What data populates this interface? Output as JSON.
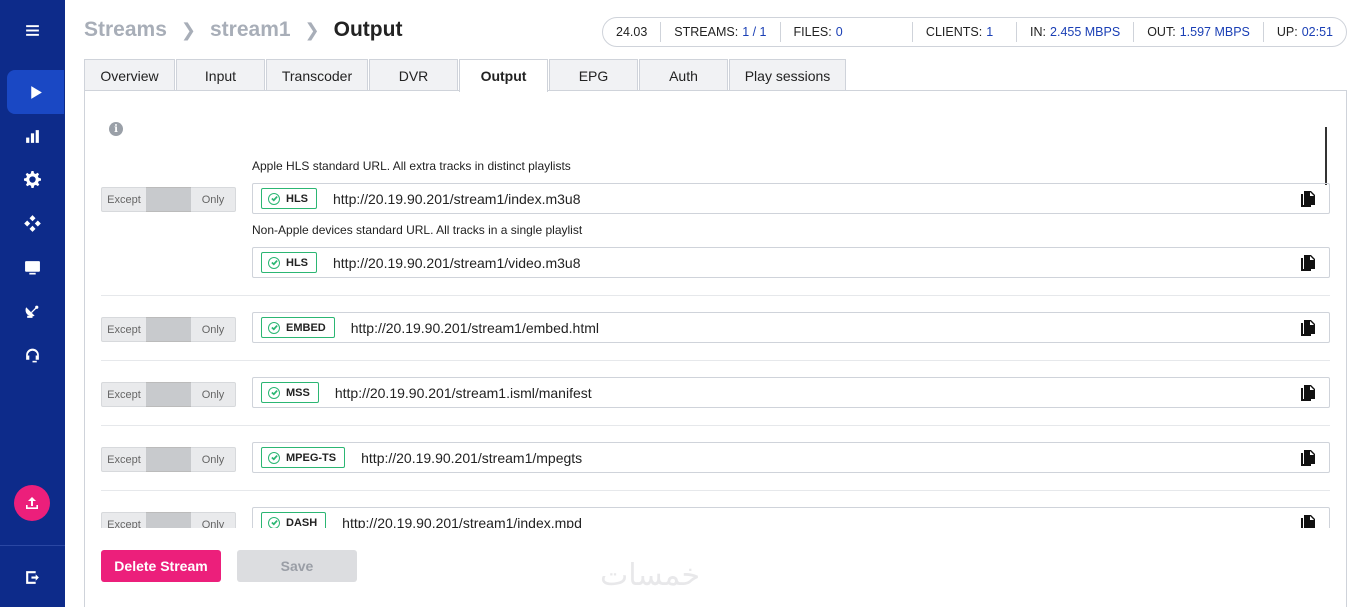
{
  "sidebar": {
    "items": [
      {
        "icon": "menu-icon"
      },
      {
        "icon": "play-icon",
        "active": true
      },
      {
        "icon": "bar-chart-icon"
      },
      {
        "icon": "gear-icon"
      },
      {
        "icon": "network-icon"
      },
      {
        "icon": "monitor-icon"
      },
      {
        "icon": "satellite-dish-icon"
      },
      {
        "icon": "headset-icon"
      }
    ],
    "upload_icon": "upload-icon",
    "logout_icon": "logout-icon"
  },
  "breadcrumb": {
    "items": [
      "Streams",
      "stream1"
    ],
    "current": "Output"
  },
  "stats": {
    "version": "24.03",
    "streams_label": "STREAMS:",
    "streams_value": "1 / 1",
    "files_label": "FILES:",
    "files_value": "0",
    "clients_label": "CLIENTS:",
    "clients_value": "1",
    "in_label": "IN:",
    "in_value": "2.455 MBPS",
    "out_label": "OUT:",
    "out_value": "1.597 MBPS",
    "up_label": "UP:",
    "up_value": "02:51"
  },
  "tabs": [
    {
      "label": "Overview"
    },
    {
      "label": "Input"
    },
    {
      "label": "Transcoder"
    },
    {
      "label": "DVR"
    },
    {
      "label": "Output",
      "active": true
    },
    {
      "label": "EPG"
    },
    {
      "label": "Auth"
    },
    {
      "label": "Play sessions"
    }
  ],
  "toggle": {
    "except_label": "Except",
    "only_label": "Only"
  },
  "outputs": {
    "hls_apple_desc": "Apple HLS standard URL. All extra tracks in distinct playlists",
    "hls_apple": {
      "badge": "HLS",
      "url": "http://20.19.90.201/stream1/index.m3u8"
    },
    "hls_nonapple_desc": "Non-Apple devices standard URL. All tracks in a single playlist",
    "hls_nonapple": {
      "badge": "HLS",
      "url": "http://20.19.90.201/stream1/video.m3u8"
    },
    "embed": {
      "badge": "EMBED",
      "url": "http://20.19.90.201/stream1/embed.html"
    },
    "mss": {
      "badge": "MSS",
      "url": "http://20.19.90.201/stream1.isml/manifest"
    },
    "mpegts": {
      "badge": "MPEG-TS",
      "url": "http://20.19.90.201/stream1/mpegts"
    },
    "dash": {
      "badge": "DASH",
      "url": "http://20.19.90.201/stream1/index.mpd"
    }
  },
  "footer": {
    "delete_label": "Delete Stream",
    "save_label": "Save"
  },
  "watermark": "خمسات"
}
